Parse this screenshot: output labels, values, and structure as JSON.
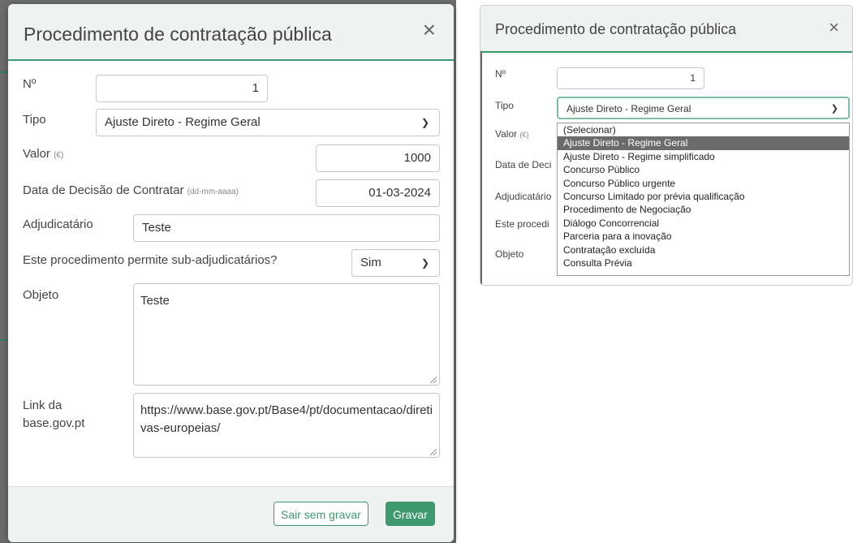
{
  "left_modal": {
    "title": "Procedimento de contratação pública",
    "close": "×",
    "fields": {
      "numero_label": "Nº",
      "numero_value": "1",
      "tipo_label": "Tipo",
      "tipo_value": "Ajuste Direto - Regime Geral",
      "valor_label": "Valor",
      "valor_unit": "(€)",
      "valor_value": "1000",
      "data_label": "Data de Decisão de Contratar",
      "data_hint": "(dd-mm-aaaa)",
      "data_value": "01-03-2024",
      "adjudicatario_label": "Adjudicatário",
      "adjudicatario_value": "Teste",
      "sub_label": "Este procedimento permite sub-adjudicatários?",
      "sub_value": "Sim",
      "objeto_label": "Objeto",
      "objeto_value": "Teste",
      "link_label": "Link da base.gov.pt",
      "link_value": "https://www.base.gov.pt/Base4/pt/documentacao/diretivas-europeias/"
    },
    "buttons": {
      "cancel": "Sair sem gravar",
      "save": "Gravar"
    }
  },
  "right_modal": {
    "title": "Procedimento de contratação pública",
    "close": "×",
    "labels": {
      "numero": "Nº",
      "numero_value": "1",
      "tipo": "Tipo",
      "tipo_value": "Ajuste Direto - Regime Geral",
      "valor": "Valor",
      "valor_unit": "(€)",
      "data": "Data de Deci",
      "adjudicatario": "Adjudicatário",
      "este": "Este procedi",
      "objeto": "Objeto"
    },
    "dropdown_options": [
      "(Selecionar)",
      "Ajuste Direto - Regime Geral",
      "Ajuste Direto - Regime simplificado",
      "Concurso Público",
      "Concurso Público urgente",
      "Concurso Limitado por prévia qualificação",
      "Procedimento de Negociação",
      "Diálogo Concorrencial",
      "Parceria para a inovação",
      "Contratação excluída",
      "Consulta Prévia"
    ],
    "selected_option": "Ajuste Direto - Regime Geral"
  },
  "icons": {
    "chevron": "chevron-down-icon",
    "close": "close-icon",
    "resize": "resize-grip-icon"
  },
  "colors": {
    "accent": "#3c9a6e",
    "header_bg": "#eef3f2",
    "selected_bg": "#6b6b6b"
  }
}
